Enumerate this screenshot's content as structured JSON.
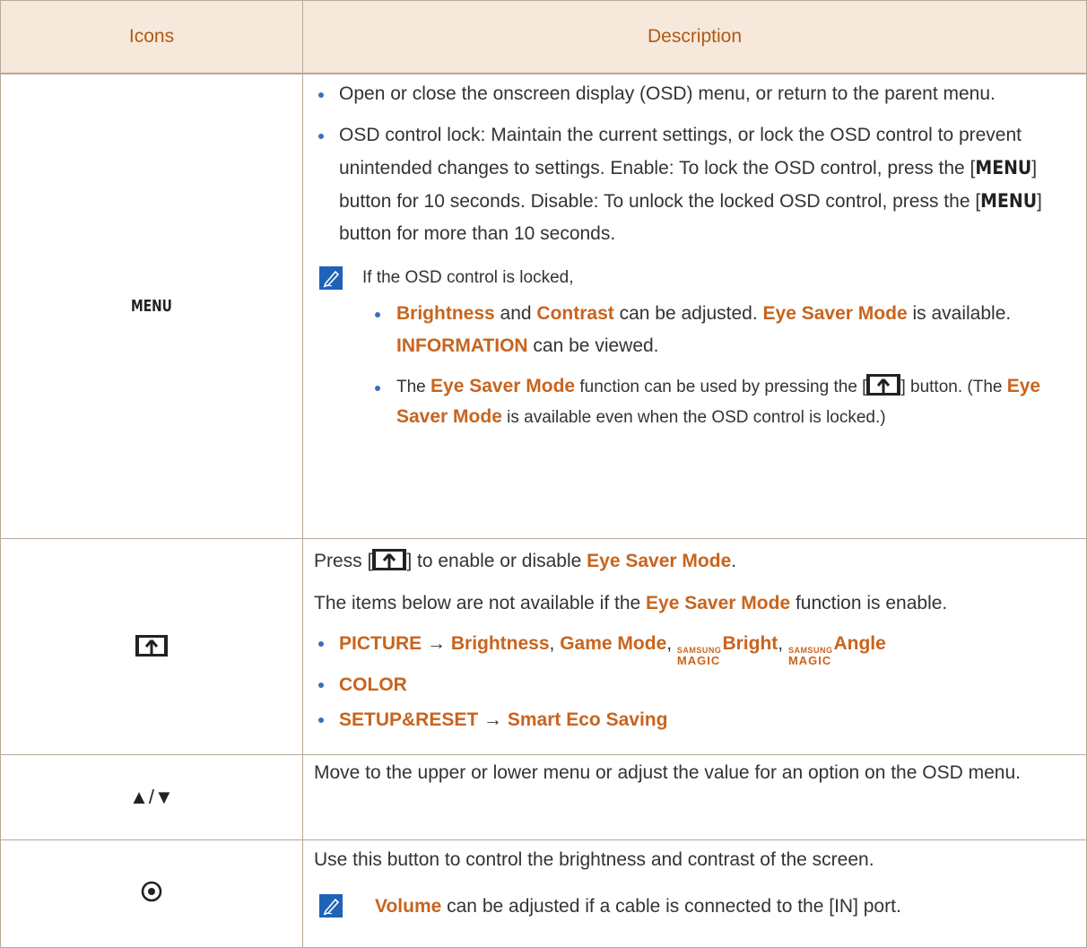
{
  "header": {
    "col_icons": "Icons",
    "col_description": "Description"
  },
  "rows": [
    {
      "icon_label": "MENU",
      "bullet1": "Open or close the onscreen display (OSD) menu, or return to the parent menu.",
      "bullet2_a": "OSD control lock: Maintain the current settings, or lock the OSD control to prevent unintended changes to settings. Enable: To lock the OSD control, press the [",
      "bullet2_key1": "MENU",
      "bullet2_b": "] button for 10 seconds. Disable: To unlock the locked OSD control, press the [",
      "bullet2_key2": "MENU",
      "bullet2_c": "] button for more than 10 seconds.",
      "note_intro": "If the OSD control is locked,",
      "note_b1": {
        "t1": "Brightness",
        "t2": " and ",
        "t3": "Contrast",
        "t4": " can be adjusted. ",
        "t5": "Eye Saver Mode",
        "t6": " is available. ",
        "t7": "INFORMATION",
        "t8": " can be viewed."
      },
      "note_b2": {
        "t1": "The ",
        "t2": "Eye Saver Mode",
        "t3": " function can be used by pressing the [",
        "t4": "] button. (The ",
        "t5": "Eye Saver Mode",
        "t6": " is available even when the OSD control is locked.)"
      }
    },
    {
      "icon_name": "eye-saver-key-icon",
      "line1_a": "Press [",
      "line1_b": "] to enable or disable ",
      "line1_c": "Eye Saver Mode",
      "line1_d": ".",
      "line2_a": "The items below are not available if the ",
      "line2_b": "Eye Saver Mode",
      "line2_c": " function is enable.",
      "item1": {
        "picture": "PICTURE",
        "arrow": " → ",
        "brightness": "Brightness",
        "sep1": ", ",
        "game_mode": "Game Mode",
        "sep2": ", ",
        "magic_top": "SAMSUNG",
        "magic_bottom": "MAGIC",
        "bright": "Bright",
        "sep3": ", ",
        "angle": "Angle"
      },
      "item2": "COLOR",
      "item3": {
        "setup": "SETUP&RESET",
        "arrow": " → ",
        "eco": "Smart Eco Saving"
      }
    },
    {
      "icon_label": "▲/▼",
      "text": "Move to the upper or lower menu or adjust the value for an option on the OSD menu."
    },
    {
      "icon_name": "jog-button-icon",
      "text": "Use this button to control the brightness and contrast of the screen.",
      "note_a": "Volume",
      "note_b": " can be adjusted if a cable is connected to the [IN] port."
    }
  ],
  "colors": {
    "accent": "#c8641e",
    "header_bg": "#f6e9db",
    "bullet": "#3b6ebc",
    "note_icon": "#1f63b8"
  }
}
